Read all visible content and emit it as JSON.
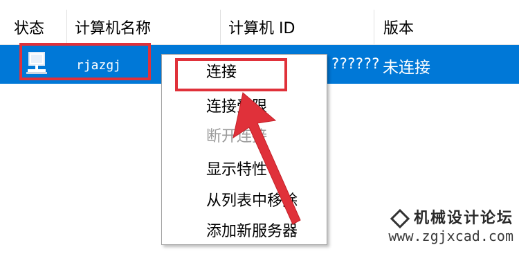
{
  "columns": [
    "状态",
    "计算机名称",
    "计算机 ID",
    "版本"
  ],
  "row": {
    "icon": "computer-icon",
    "name": "rjazgj",
    "id": "??????",
    "version": "未连接"
  },
  "menu": {
    "items": [
      {
        "label": "连接",
        "disabled": false
      },
      {
        "label": "连接受限",
        "disabled": false
      },
      {
        "label": "断开连接",
        "disabled": true
      },
      {
        "label": "显示特性",
        "disabled": false
      },
      {
        "label": "从列表中移除",
        "disabled": false
      },
      {
        "label": "添加新服务器",
        "disabled": false
      }
    ]
  },
  "watermark": {
    "logo": "机械设计论坛",
    "url": "www.zgjxcad.com"
  },
  "colors": {
    "selection": "#0078d7",
    "highlight": "#e0313a"
  }
}
